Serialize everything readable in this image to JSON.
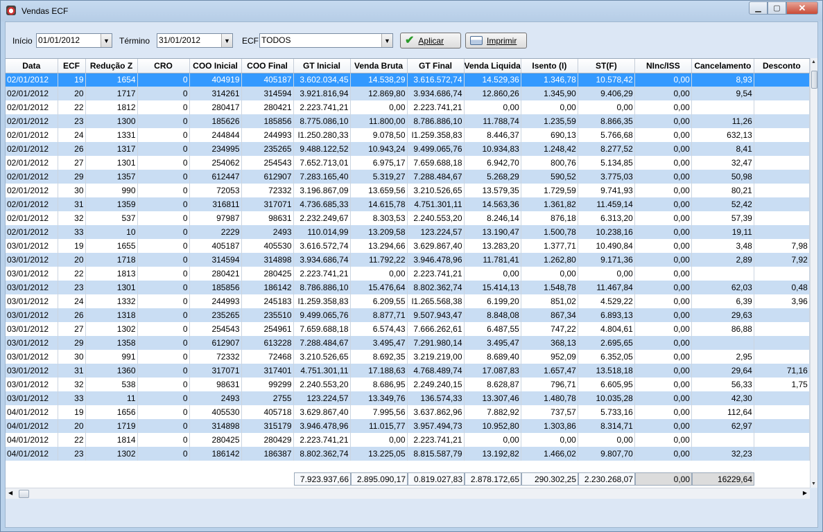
{
  "window": {
    "title": "Vendas ECF"
  },
  "filters": {
    "inicio_label": "Início",
    "inicio_value": "01/01/2012",
    "termino_label": "Término",
    "termino_value": "31/01/2012",
    "ecf_label": "ECF",
    "ecf_value": "TODOS",
    "aplicar_label": "Aplicar",
    "imprimir_label": "Imprimir"
  },
  "table": {
    "columns": [
      "Data",
      "ECF",
      "Redução Z",
      "CRO",
      "COO Inicial",
      "COO Final",
      "GT Inicial",
      "Venda Bruta",
      "GT Final",
      "Venda Liquida",
      "Isento (I)",
      "ST(F)",
      "NInc/ISS",
      "Cancelamento",
      "Desconto"
    ],
    "selected_row": 0,
    "rows": [
      [
        "02/01/2012",
        "19",
        "1654",
        "0",
        "404919",
        "405187",
        "3.602.034,45",
        "14.538,29",
        "3.616.572,74",
        "14.529,36",
        "1.346,78",
        "10.578,42",
        "0,00",
        "8,93",
        ""
      ],
      [
        "02/01/2012",
        "20",
        "1717",
        "0",
        "314261",
        "314594",
        "3.921.816,94",
        "12.869,80",
        "3.934.686,74",
        "12.860,26",
        "1.345,90",
        "9.406,29",
        "0,00",
        "9,54",
        ""
      ],
      [
        "02/01/2012",
        "22",
        "1812",
        "0",
        "280417",
        "280421",
        "2.223.741,21",
        "0,00",
        "2.223.741,21",
        "0,00",
        "0,00",
        "0,00",
        "0,00",
        "",
        ""
      ],
      [
        "02/01/2012",
        "23",
        "1300",
        "0",
        "185626",
        "185856",
        "8.775.086,10",
        "11.800,00",
        "8.786.886,10",
        "11.788,74",
        "1.235,59",
        "8.866,35",
        "0,00",
        "11,26",
        ""
      ],
      [
        "02/01/2012",
        "24",
        "1331",
        "0",
        "244844",
        "244993",
        "l1.250.280,33",
        "9.078,50",
        "l1.259.358,83",
        "8.446,37",
        "690,13",
        "5.766,68",
        "0,00",
        "632,13",
        ""
      ],
      [
        "02/01/2012",
        "26",
        "1317",
        "0",
        "234995",
        "235265",
        "9.488.122,52",
        "10.943,24",
        "9.499.065,76",
        "10.934,83",
        "1.248,42",
        "8.277,52",
        "0,00",
        "8,41",
        ""
      ],
      [
        "02/01/2012",
        "27",
        "1301",
        "0",
        "254062",
        "254543",
        "7.652.713,01",
        "6.975,17",
        "7.659.688,18",
        "6.942,70",
        "800,76",
        "5.134,85",
        "0,00",
        "32,47",
        ""
      ],
      [
        "02/01/2012",
        "29",
        "1357",
        "0",
        "612447",
        "612907",
        "7.283.165,40",
        "5.319,27",
        "7.288.484,67",
        "5.268,29",
        "590,52",
        "3.775,03",
        "0,00",
        "50,98",
        ""
      ],
      [
        "02/01/2012",
        "30",
        "990",
        "0",
        "72053",
        "72332",
        "3.196.867,09",
        "13.659,56",
        "3.210.526,65",
        "13.579,35",
        "1.729,59",
        "9.741,93",
        "0,00",
        "80,21",
        ""
      ],
      [
        "02/01/2012",
        "31",
        "1359",
        "0",
        "316811",
        "317071",
        "4.736.685,33",
        "14.615,78",
        "4.751.301,11",
        "14.563,36",
        "1.361,82",
        "11.459,14",
        "0,00",
        "52,42",
        ""
      ],
      [
        "02/01/2012",
        "32",
        "537",
        "0",
        "97987",
        "98631",
        "2.232.249,67",
        "8.303,53",
        "2.240.553,20",
        "8.246,14",
        "876,18",
        "6.313,20",
        "0,00",
        "57,39",
        ""
      ],
      [
        "02/01/2012",
        "33",
        "10",
        "0",
        "2229",
        "2493",
        "110.014,99",
        "13.209,58",
        "123.224,57",
        "13.190,47",
        "1.500,78",
        "10.238,16",
        "0,00",
        "19,11",
        ""
      ],
      [
        "03/01/2012",
        "19",
        "1655",
        "0",
        "405187",
        "405530",
        "3.616.572,74",
        "13.294,66",
        "3.629.867,40",
        "13.283,20",
        "1.377,71",
        "10.490,84",
        "0,00",
        "3,48",
        "7,98"
      ],
      [
        "03/01/2012",
        "20",
        "1718",
        "0",
        "314594",
        "314898",
        "3.934.686,74",
        "11.792,22",
        "3.946.478,96",
        "11.781,41",
        "1.262,80",
        "9.171,36",
        "0,00",
        "2,89",
        "7,92"
      ],
      [
        "03/01/2012",
        "22",
        "1813",
        "0",
        "280421",
        "280425",
        "2.223.741,21",
        "0,00",
        "2.223.741,21",
        "0,00",
        "0,00",
        "0,00",
        "0,00",
        "",
        ""
      ],
      [
        "03/01/2012",
        "23",
        "1301",
        "0",
        "185856",
        "186142",
        "8.786.886,10",
        "15.476,64",
        "8.802.362,74",
        "15.414,13",
        "1.548,78",
        "11.467,84",
        "0,00",
        "62,03",
        "0,48"
      ],
      [
        "03/01/2012",
        "24",
        "1332",
        "0",
        "244993",
        "245183",
        "l1.259.358,83",
        "6.209,55",
        "l1.265.568,38",
        "6.199,20",
        "851,02",
        "4.529,22",
        "0,00",
        "6,39",
        "3,96"
      ],
      [
        "03/01/2012",
        "26",
        "1318",
        "0",
        "235265",
        "235510",
        "9.499.065,76",
        "8.877,71",
        "9.507.943,47",
        "8.848,08",
        "867,34",
        "6.893,13",
        "0,00",
        "29,63",
        ""
      ],
      [
        "03/01/2012",
        "27",
        "1302",
        "0",
        "254543",
        "254961",
        "7.659.688,18",
        "6.574,43",
        "7.666.262,61",
        "6.487,55",
        "747,22",
        "4.804,61",
        "0,00",
        "86,88",
        ""
      ],
      [
        "03/01/2012",
        "29",
        "1358",
        "0",
        "612907",
        "613228",
        "7.288.484,67",
        "3.495,47",
        "7.291.980,14",
        "3.495,47",
        "368,13",
        "2.695,65",
        "0,00",
        "",
        ""
      ],
      [
        "03/01/2012",
        "30",
        "991",
        "0",
        "72332",
        "72468",
        "3.210.526,65",
        "8.692,35",
        "3.219.219,00",
        "8.689,40",
        "952,09",
        "6.352,05",
        "0,00",
        "2,95",
        ""
      ],
      [
        "03/01/2012",
        "31",
        "1360",
        "0",
        "317071",
        "317401",
        "4.751.301,11",
        "17.188,63",
        "4.768.489,74",
        "17.087,83",
        "1.657,47",
        "13.518,18",
        "0,00",
        "29,64",
        "71,16"
      ],
      [
        "03/01/2012",
        "32",
        "538",
        "0",
        "98631",
        "99299",
        "2.240.553,20",
        "8.686,95",
        "2.249.240,15",
        "8.628,87",
        "796,71",
        "6.605,95",
        "0,00",
        "56,33",
        "1,75"
      ],
      [
        "03/01/2012",
        "33",
        "11",
        "0",
        "2493",
        "2755",
        "123.224,57",
        "13.349,76",
        "136.574,33",
        "13.307,46",
        "1.480,78",
        "10.035,28",
        "0,00",
        "42,30",
        ""
      ],
      [
        "04/01/2012",
        "19",
        "1656",
        "0",
        "405530",
        "405718",
        "3.629.867,40",
        "7.995,56",
        "3.637.862,96",
        "7.882,92",
        "737,57",
        "5.733,16",
        "0,00",
        "112,64",
        ""
      ],
      [
        "04/01/2012",
        "20",
        "1719",
        "0",
        "314898",
        "315179",
        "3.946.478,96",
        "11.015,77",
        "3.957.494,73",
        "10.952,80",
        "1.303,86",
        "8.314,71",
        "0,00",
        "62,97",
        ""
      ],
      [
        "04/01/2012",
        "22",
        "1814",
        "0",
        "280425",
        "280429",
        "2.223.741,21",
        "0,00",
        "2.223.741,21",
        "0,00",
        "0,00",
        "0,00",
        "0,00",
        "",
        ""
      ],
      [
        "04/01/2012",
        "23",
        "1302",
        "0",
        "186142",
        "186387",
        "8.802.362,74",
        "13.225,05",
        "8.815.587,79",
        "13.192,82",
        "1.466,02",
        "9.807,70",
        "0,00",
        "32,23",
        ""
      ]
    ]
  },
  "totals": {
    "gt_inicial": "7.923.937,66",
    "venda_bruta": "2.895.090,17",
    "gt_final": "0.819.027,83",
    "venda_liquida": "2.878.172,65",
    "isento": "290.302,25",
    "st": "2.230.268,07",
    "ninc_iss": "0,00",
    "cancelamento": "16229,64"
  }
}
